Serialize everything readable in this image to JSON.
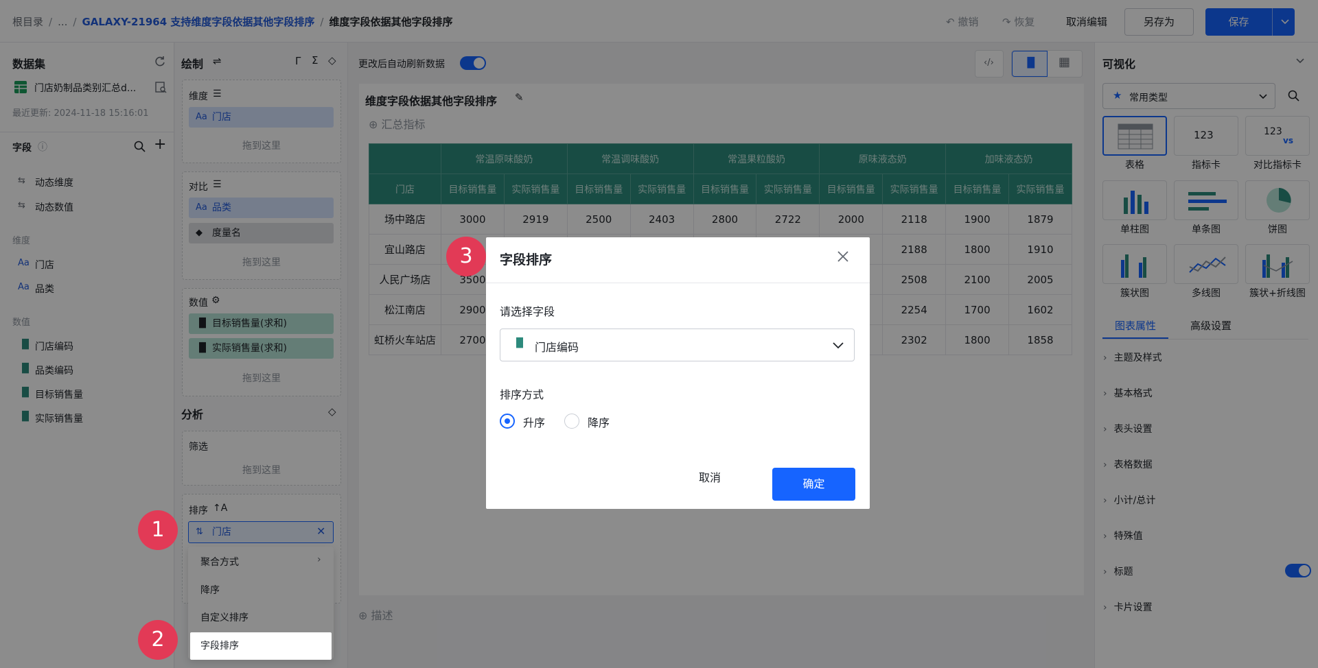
{
  "breadcrumb": {
    "root": "根目录",
    "ellipsis": "...",
    "parent": "GALAXY-21964 支持维度字段依据其他字段排序",
    "current": "维度字段依据其他字段排序"
  },
  "toolbar": {
    "undo": "撤销",
    "redo": "恢复",
    "cancel_edit": "取消编辑",
    "save_as": "另存为",
    "save": "保存"
  },
  "dataset": {
    "title": "数据集",
    "name": "门店奶制品类别汇总d...",
    "updated": "最近更新: 2024-11-18 15:16:01",
    "fields_title": "字段",
    "dynamic": [
      "动态维度",
      "动态数值"
    ],
    "dim_title": "维度",
    "dims": [
      "门店",
      "品类"
    ],
    "val_title": "数值",
    "vals": [
      "门店编码",
      "品类编码",
      "目标销售量",
      "实际销售量"
    ]
  },
  "draw": {
    "title": "绘制",
    "dim_label": "维度",
    "dim_chip": "门店",
    "drop_here": "拖到这里",
    "compare_label": "对比",
    "compare_chips": [
      "品类",
      "度量名"
    ],
    "value_label": "数值",
    "value_chips": [
      "目标销售量(求和)",
      "实际销售量(求和)"
    ],
    "analysis_title": "分析",
    "filter_label": "筛选",
    "sort_label": "排序",
    "sort_chip": "门店"
  },
  "context_menu": {
    "items": [
      "聚合方式",
      "降序",
      "自定义排序"
    ],
    "highlighted": "字段排序"
  },
  "center": {
    "auto_refresh": "更改后自动刷新数据",
    "chart_title": "维度字段依据其他字段排序",
    "summary": "汇总指标",
    "describe": "描述"
  },
  "table": {
    "row_header": "门店",
    "groups": [
      "常温原味酸奶",
      "常温调味酸奶",
      "常温果粒酸奶",
      "原味液态奶",
      "加味液态奶"
    ],
    "sub_headers": [
      "目标销售量",
      "实际销售量"
    ],
    "rows": [
      [
        "场中路店",
        "3000",
        "2919",
        "2500",
        "2403",
        "2800",
        "2722",
        "2000",
        "2118",
        "1900",
        "1879"
      ],
      [
        "宜山路店",
        "",
        "",
        "",
        "",
        "",
        "",
        "",
        "2188",
        "1800",
        "1910"
      ],
      [
        "人民广场店",
        "3500",
        "",
        "",
        "",
        "",
        "",
        "",
        "2508",
        "2100",
        "2005"
      ],
      [
        "松江南店",
        "2900",
        "",
        "",
        "",
        "",
        "",
        "",
        "2254",
        "1700",
        "1602"
      ],
      [
        "虹桥火车站店",
        "2700",
        "",
        "",
        "",
        "",
        "",
        "",
        "2302",
        "1800",
        "1858"
      ]
    ]
  },
  "visual": {
    "title": "可视化",
    "type_select": "常用类型",
    "types": [
      "表格",
      "指标卡",
      "对比指标卡",
      "单柱图",
      "单条图",
      "饼图",
      "簇状图",
      "多线图",
      "簇状+折线图"
    ],
    "card_num": "123",
    "card_vs": "vs",
    "tabs": [
      "图表属性",
      "高级设置"
    ],
    "sections": [
      "主题及样式",
      "基本格式",
      "表头设置",
      "表格数据",
      "小计/总计",
      "特殊值",
      "标题",
      "卡片设置"
    ]
  },
  "dialog": {
    "title": "字段排序",
    "field_label": "请选择字段",
    "field_value": "门店编码",
    "order_label": "排序方式",
    "asc": "升序",
    "desc": "降序",
    "cancel": "取消",
    "ok": "确定"
  },
  "markers": [
    "1",
    "2",
    "3"
  ],
  "colors": {
    "primary": "#1664ff",
    "table_header": "#2d8a7c",
    "marker": "#e23a56"
  }
}
